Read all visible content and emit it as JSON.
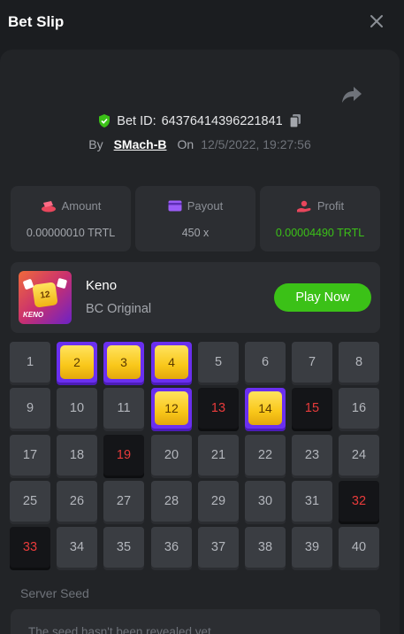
{
  "header": {
    "title": "Bet Slip"
  },
  "bet": {
    "id_label": "Bet ID:",
    "id_value": "64376414396221841",
    "by_label": "By",
    "user": "SMach-B",
    "on_label": "On",
    "date": "12/5/2022, 19:27:56"
  },
  "stats": [
    {
      "label": "Amount",
      "value": "0.00000010 TRTL",
      "icon": "coins-icon",
      "color": "#e8465c"
    },
    {
      "label": "Payout",
      "value": "450 x",
      "icon": "card-icon",
      "color": "#9b5cf6"
    },
    {
      "label": "Profit",
      "value": "0.00004490 TRTL",
      "icon": "hand-icon",
      "color": "#e8465c",
      "value_color": "#3bc117"
    }
  ],
  "game": {
    "name": "Keno",
    "subtitle": "BC Original",
    "thumb_text": "KENO",
    "thumb_tile": "12",
    "play_label": "Play Now"
  },
  "keno": {
    "numbers": [
      1,
      2,
      3,
      4,
      5,
      6,
      7,
      8,
      9,
      10,
      11,
      12,
      13,
      14,
      15,
      16,
      17,
      18,
      19,
      20,
      21,
      22,
      23,
      24,
      25,
      26,
      27,
      28,
      29,
      30,
      31,
      32,
      33,
      34,
      35,
      36,
      37,
      38,
      39,
      40
    ],
    "hits": [
      2,
      3,
      4,
      12,
      14
    ],
    "misses": [
      13,
      15,
      19,
      32,
      33
    ]
  },
  "seed": {
    "label": "Server Seed",
    "text": "The seed hasn't been revealed yet"
  },
  "colors": {
    "accent_green": "#3bc117",
    "hit_purple": "#6a2ff0",
    "miss_red": "#e83b3b"
  }
}
